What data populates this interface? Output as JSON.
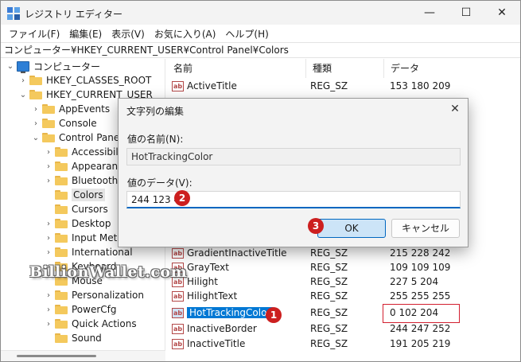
{
  "window": {
    "title": "レジストリ エディター"
  },
  "controls": {
    "minimize": "—",
    "maximize": "☐",
    "close": "✕"
  },
  "menu": [
    "ファイル(F)",
    "編集(E)",
    "表示(V)",
    "お気に入り(A)",
    "ヘルプ(H)"
  ],
  "address": "コンピューター¥HKEY_CURRENT_USER¥Control Panel¥Colors",
  "tree": {
    "root": "コンピューター",
    "classes_root": "HKEY_CLASSES_ROOT",
    "current_user": "HKEY_CURRENT_USER",
    "app_events": "AppEvents",
    "console": "Console",
    "control_panel": "Control Panel",
    "accessibility": "Accessibili",
    "appearance": "Appearanc",
    "bluetooth": "Bluetooth",
    "colors": "Colors",
    "cursors": "Cursors",
    "desktop": "Desktop",
    "input_method": "Input Meth",
    "international": "International",
    "keyboard": "Keyboard",
    "mouse": "Mouse",
    "personalization": "Personalization",
    "powercfg": "PowerCfg",
    "quick_actions": "Quick Actions",
    "sound": "Sound"
  },
  "columns": {
    "name": "名前",
    "type": "種類",
    "data": "データ"
  },
  "rows": {
    "active_title": {
      "name": "ActiveTitle",
      "type": "REG_SZ",
      "data": "153 180 209"
    },
    "gradient_inactive": {
      "name": "GradientInactiveTitle",
      "type": "REG_SZ",
      "data": "215 228 242"
    },
    "gray_text": {
      "name": "GrayText",
      "type": "REG_SZ",
      "data": "109 109 109"
    },
    "hilight": {
      "name": "Hilight",
      "type": "REG_SZ",
      "data": "227 5 204"
    },
    "hilight_text": {
      "name": "HilightText",
      "type": "REG_SZ",
      "data": "255 255 255"
    },
    "hot_tracking": {
      "name": "HotTrackingColor",
      "type": "REG_SZ",
      "data": "0 102 204"
    },
    "inactive_border": {
      "name": "InactiveBorder",
      "type": "REG_SZ",
      "data": "244 247 252"
    },
    "inactive_title": {
      "name": "InactiveTitle",
      "type": "REG_SZ",
      "data": "191 205 219"
    }
  },
  "reg_icon_text": "ab",
  "dialog": {
    "title": "文字列の編集",
    "close": "✕",
    "name_label": "値の名前(N):",
    "name_value": "HotTrackingColor",
    "data_label": "値のデータ(V):",
    "data_value": "244 123 4",
    "ok": "OK",
    "cancel": "キャンセル"
  },
  "badges": {
    "one": "1",
    "two": "2",
    "three": "3"
  },
  "watermark": "BillionWallet.com",
  "colors": {
    "accent": "#0078d4",
    "badge": "#cc1f1f",
    "highlight_box": "#d21f2f"
  }
}
